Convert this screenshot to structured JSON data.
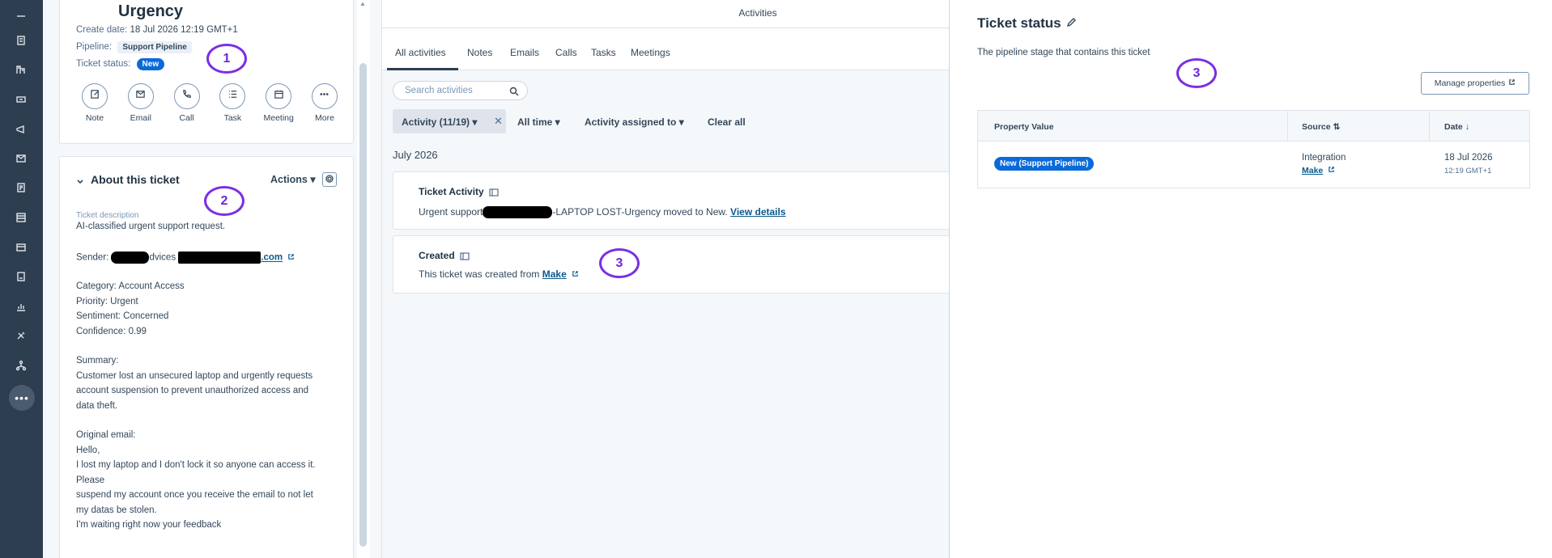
{
  "record": {
    "title": "Urgency",
    "create_date_label": "Create date:",
    "create_date_value": "18 Jul 2026 12:19 GMT+1",
    "pipeline_label": "Pipeline:",
    "pipeline_value": "Support Pipeline",
    "status_label": "Ticket status:",
    "status_value": "New",
    "actions": [
      {
        "label": "Note",
        "icon": "note-icon"
      },
      {
        "label": "Email",
        "icon": "email-icon"
      },
      {
        "label": "Call",
        "icon": "call-icon"
      },
      {
        "label": "Task",
        "icon": "task-icon"
      },
      {
        "label": "Meeting",
        "icon": "meeting-icon"
      },
      {
        "label": "More",
        "icon": "more-icon"
      }
    ]
  },
  "about": {
    "title": "About this ticket",
    "actions_label": "Actions",
    "desc_label": "Ticket description",
    "line1": "AI-classified urgent support request.",
    "sender_prefix": "Sender:",
    "sender_mid": "dvices",
    "sender_link": ".com",
    "category": "Category: Account Access",
    "priority": "Priority: Urgent",
    "sentiment": "Sentiment: Concerned",
    "confidence": "Confidence: 0.99",
    "summary_label": "Summary:",
    "summary_1": "Customer lost an unsecured laptop and urgently requests",
    "summary_2": "account suspension to prevent unauthorized access and",
    "summary_3": "data theft.",
    "orig_label": "Original email:",
    "email_1": "Hello,",
    "email_2": "I lost my laptop and I don't lock it so anyone can access it.",
    "email_3": "Please",
    "email_4": "suspend my account once you receive the email to not let",
    "email_5": "my datas be stolen.",
    "email_6": "I'm waiting right now your feedback"
  },
  "activities": {
    "header": "Activities",
    "tabs": [
      "All activities",
      "Notes",
      "Emails",
      "Calls",
      "Tasks",
      "Meetings"
    ],
    "search_placeholder": "Search activities",
    "filter_chip": "Activity (11/19)",
    "filter_time": "All time",
    "filter_assigned": "Activity assigned to",
    "clear_all": "Clear all",
    "month": "July 2026",
    "item1_title": "Ticket Activity",
    "item1_prefix": "Urgent support",
    "item1_suffix": "-LAPTOP LOST-Urgency moved to New.",
    "item1_link": "View details",
    "item2_title": "Created",
    "item2_text": "This ticket was created from",
    "item2_link": "Make"
  },
  "annotations": [
    "1",
    "2",
    "3",
    "3"
  ],
  "property_panel": {
    "title": "Ticket status",
    "description": "The pipeline stage that contains this ticket",
    "manage_button": "Manage properties",
    "columns": [
      "Property Value",
      "Source",
      "Date"
    ],
    "row": {
      "value": "New (Support Pipeline)",
      "source": "Integration",
      "source_link": "Make",
      "date": "18 Jul 2026",
      "time": "12:19 GMT+1"
    }
  },
  "colors": {
    "nav_bg": "#2d3e50",
    "accent_blue": "#0b6ad9",
    "link": "#0b5a8c",
    "annotation": "#7b2fe3"
  }
}
